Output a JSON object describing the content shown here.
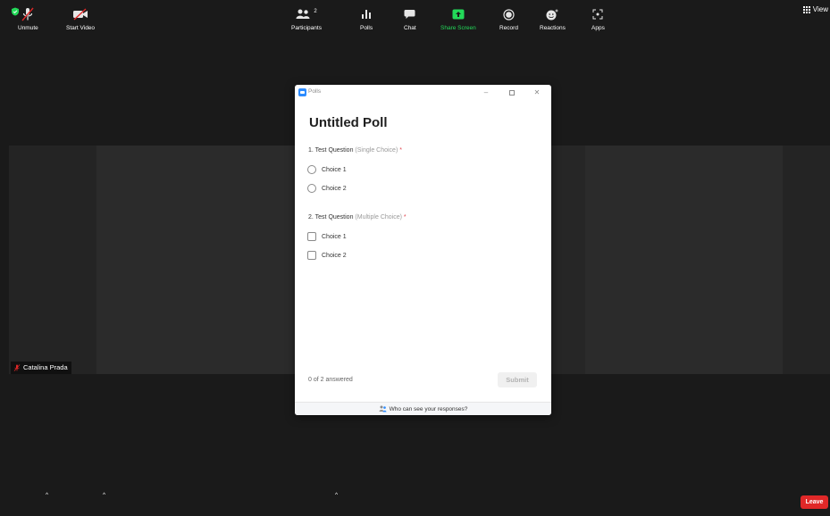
{
  "top": {
    "view_label": "View"
  },
  "participant": {
    "name": "Catalina Prada"
  },
  "poll_window": {
    "window_title": "Polls",
    "heading": "Untitled Poll",
    "questions": [
      {
        "prefix": "1. Test Question",
        "type": "(Single Choice)",
        "required_mark": "*",
        "choices": [
          "Choice 1",
          "Choice 2"
        ]
      },
      {
        "prefix": "2. Test Question",
        "type": "(Multiple Choice)",
        "required_mark": "*",
        "choices": [
          "Choice 1",
          "Choice 2"
        ]
      }
    ],
    "answered_status": "0 of 2 answered",
    "submit_label": "Submit",
    "footer_link": "Who can see your responses?"
  },
  "toolbar": {
    "unmute": "Unmute",
    "start_video": "Start Video",
    "participants": "Participants",
    "participant_count": "2",
    "polls": "Polls",
    "chat": "Chat",
    "share_screen": "Share Screen",
    "record": "Record",
    "reactions": "Reactions",
    "apps": "Apps",
    "leave": "Leave"
  },
  "colors": {
    "background": "#1a1a1a",
    "accent_blue": "#2d8cff",
    "share_green": "#23d959",
    "leave_red": "#e02828",
    "required_red": "#e0454f"
  }
}
